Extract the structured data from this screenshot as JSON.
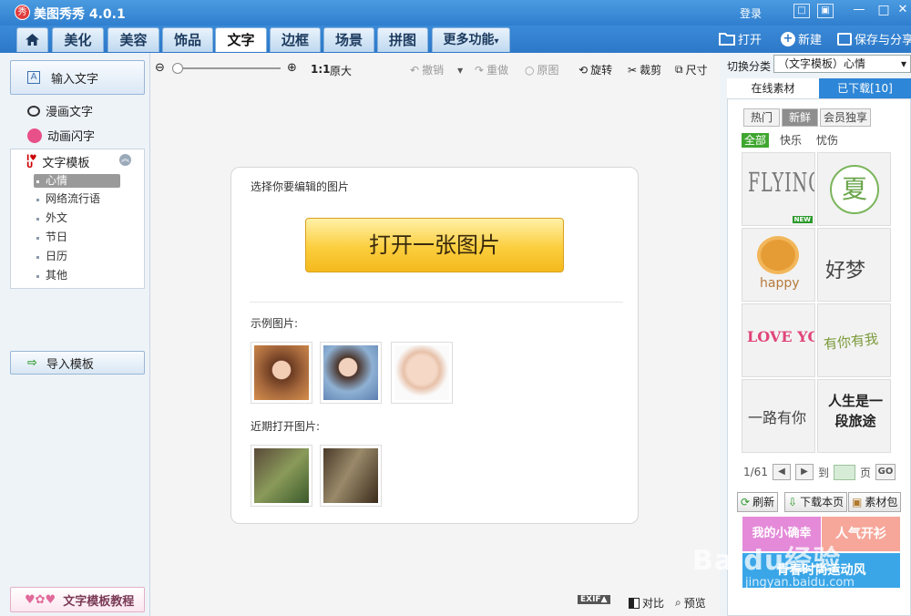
{
  "app": {
    "logo_char": "秀",
    "title": "美图秀秀 4.0.1",
    "login": "登录"
  },
  "titlebar_buttons": [
    {
      "name": "messages-icon",
      "glyph": "□"
    },
    {
      "name": "menu-icon",
      "glyph": "▣"
    },
    {
      "name": "minimize-icon",
      "glyph": "—"
    },
    {
      "name": "maximize-icon",
      "glyph": "□"
    },
    {
      "name": "close-icon",
      "glyph": "✕"
    }
  ],
  "tabs": [
    "美化",
    "美容",
    "饰品",
    "文字",
    "边框",
    "场景",
    "拼图",
    "更多功能"
  ],
  "active_tab": "文字",
  "top_right": {
    "open": "打开",
    "new": "新建",
    "save_share": "保存与分享"
  },
  "left": {
    "input_text": "输入文字",
    "input_icon": "A",
    "comic_text": "漫画文字",
    "animated_text": "动画闪字",
    "template_header": "文字模板",
    "template_items": [
      "心情",
      "网络流行语",
      "外文",
      "节日",
      "日历",
      "其他"
    ],
    "selected_template": "心情",
    "import_template": "导入模板",
    "tutorial": "文字模板教程"
  },
  "toolbar": {
    "ratio": "1:1",
    "original_size": "原大",
    "undo": "撤销",
    "redo": "重做",
    "original_image": "原图",
    "rotate": "旋转",
    "crop": "裁剪",
    "size": "尺寸"
  },
  "welcome": {
    "prompt": "选择你要编辑的图片",
    "open_button": "打开一张图片",
    "examples_label": "示例图片:",
    "recent_label": "近期打开图片:"
  },
  "bottom": {
    "exif": "EXIF▲",
    "compare": "对比",
    "preview": "预览"
  },
  "right": {
    "category_label": "切换分类",
    "category_value": "（文字模板）心情",
    "tabs": [
      "在线素材",
      "已下载[10]"
    ],
    "segments": [
      "热门",
      "新鲜",
      "会员独享"
    ],
    "active_segment": "新鲜",
    "filters": [
      "全部",
      "快乐",
      "忧伤"
    ],
    "active_filter": "全部",
    "grid": [
      "FLYING",
      "夏",
      "happy",
      "好梦",
      "LOVE YOU",
      "有你有我",
      "一路有你",
      "人生是一段旅途"
    ],
    "new_badge": "NEW",
    "page_info": "1/61",
    "go_to": "到",
    "page_unit": "页",
    "go": "GO",
    "refresh": "刷新",
    "download_page": "下载本页",
    "material_pack": "素材包",
    "banners": [
      "我的小确幸",
      "人气开衫",
      "青春时尚运动风"
    ]
  },
  "watermark": {
    "brand": "Baidu经验",
    "url": "jingyan.baidu.com"
  }
}
